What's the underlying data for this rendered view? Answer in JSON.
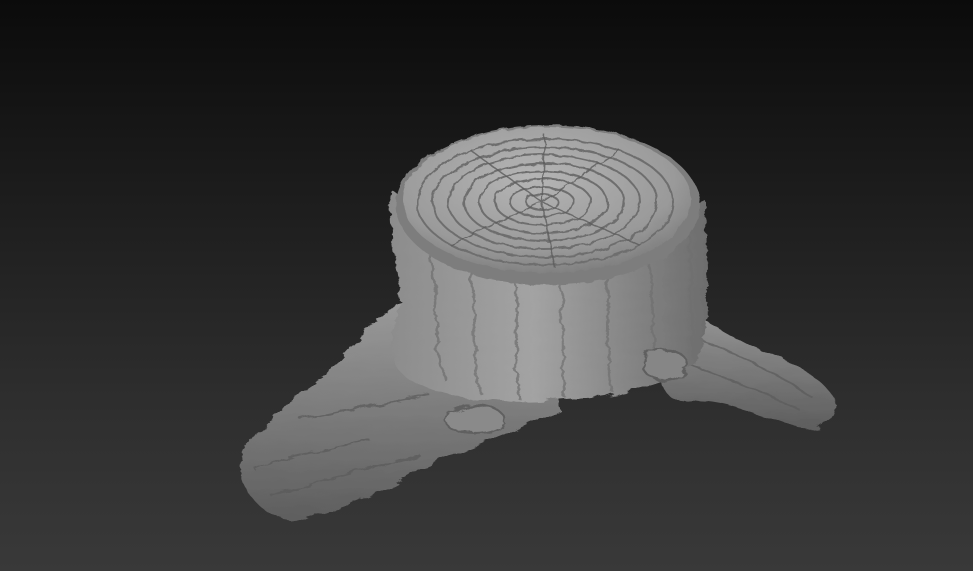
{
  "viewport": {
    "subject": "tree-stump",
    "background_top_color": "#0b0b0b",
    "background_bottom_color": "#393939",
    "material_color": "#9a9a9a",
    "rim_color": "#7a7a7a"
  }
}
